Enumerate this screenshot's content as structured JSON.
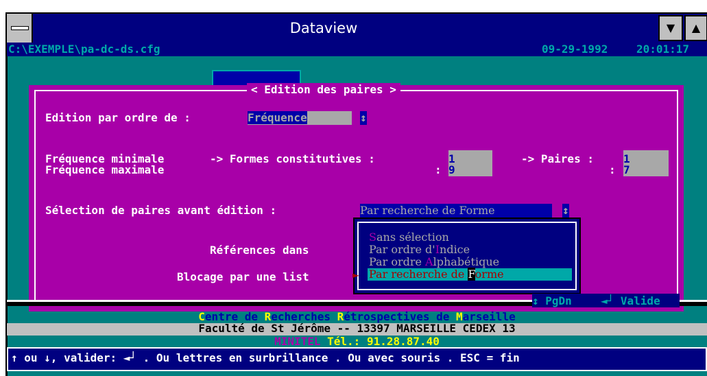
{
  "window": {
    "title": "Dataview",
    "sys_menu_icon": "minus-bar",
    "btn_down": "▼",
    "btn_up": "▲"
  },
  "header": {
    "config_path": "C:\\EXEMPLE\\pa-dc-ds.cfg",
    "date": "09-29-1992",
    "time": "20:01:17"
  },
  "dialog": {
    "title": "< Edition des paires >",
    "order_label": "Edition par ordre de :",
    "order_value": "Fréquence",
    "order_arrow": "↕",
    "freq_min_label": "Fréquence minimale",
    "freq_max_label": "Fréquence maximale",
    "forms_label": "-> Formes constitutives :",
    "forms_colon": ":",
    "forms_min": "1",
    "forms_max": "9",
    "pairs_label": "-> Paires :",
    "pairs_colon": ":",
    "pairs_min": "1",
    "pairs_max": "7",
    "selection_label": "Sélection de paires avant édition :",
    "selection_value": "Par recherche de Forme",
    "selection_arrow": "↕",
    "references_label": "Références dans",
    "blocking_label": "Blocage par une list",
    "pgdn_label": "↕ PgDn",
    "valid_label": "◄┘ Valide"
  },
  "dropdown": {
    "options": [
      {
        "hot": "S",
        "rest": "ans sélection"
      },
      {
        "pre": "Par ordre d'",
        "hot": "I",
        "rest": "ndice"
      },
      {
        "pre": "Par ordre ",
        "hot": "A",
        "rest": "lphabétique"
      },
      {
        "pre": "Par recherche de ",
        "hot": "F",
        "rest": "orme"
      }
    ],
    "selected_index": 3,
    "pointer": "►"
  },
  "credits": {
    "line1_parts": [
      "C",
      "entre de ",
      "R",
      "echerches ",
      "R",
      "étrospectives de ",
      "M",
      "arseille"
    ],
    "line2": "Faculté de St Jérôme -- 13397 MARSEILLE CEDEX 13",
    "line3_a": "MINITEL",
    "line3_b": " Tél.: 91.28.87.40"
  },
  "status_bar": {
    "text": "↑ ou ↓, valider: ◄┘ . Ou lettres en surbrillance . Ou avec souris . ESC = fin"
  },
  "colors": {
    "teal": "#008080",
    "magenta": "#a800a8",
    "navy": "#000080",
    "gray": "#a8a8a8"
  }
}
